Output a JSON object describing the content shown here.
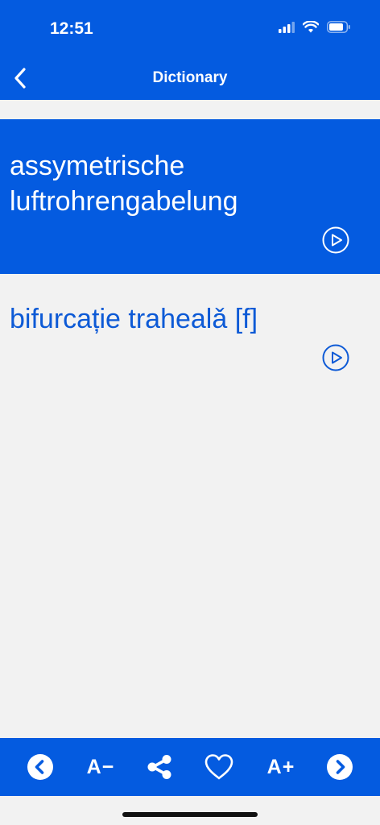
{
  "status_bar": {
    "time": "12:51"
  },
  "nav": {
    "title": "Dictionary"
  },
  "entry": {
    "source_term": "assymetrische luftrohrengabelung",
    "translation": "bifurcație trahealǎ [f]"
  },
  "toolbar": {
    "decrease_font_label": "A−",
    "increase_font_label": "A+"
  },
  "colors": {
    "primary": "#045be0",
    "background": "#f2f2f2",
    "translation_text": "#0d5ad6"
  }
}
